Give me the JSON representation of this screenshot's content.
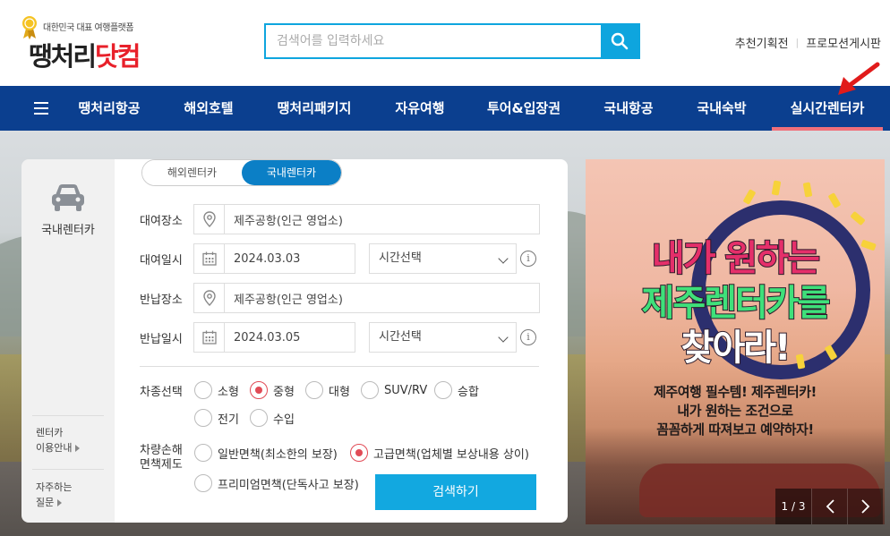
{
  "header": {
    "logo_tagline": "대한민국 대표 여행플랫폼",
    "logo_name_part1": "땡처리",
    "logo_name_part2": "닷컴",
    "search_placeholder": "검색어를 입력하세요",
    "top_links": [
      "추천기획전",
      "프로모션게시판"
    ]
  },
  "nav": {
    "items": [
      "땡처리항공",
      "해외호텔",
      "땡처리패키지",
      "자유여행",
      "투어&입장권",
      "국내항공",
      "국내숙박",
      "실시간렌터카"
    ],
    "active": "실시간렌터카",
    "active_color": "#f0707a",
    "bg_color": "#0b3f8f"
  },
  "sidepanel": {
    "title": "국내렌터카",
    "links": [
      {
        "line1": "렌터카",
        "line2": "이용안내"
      },
      {
        "line1": "자주하는",
        "line2": "질문"
      }
    ]
  },
  "form": {
    "tabs": [
      "해외렌터카",
      "국내렌터카"
    ],
    "active_tab": "국내렌터카",
    "rental_place_label": "대여장소",
    "rental_place_value": "제주공항(인근 영업소)",
    "rental_date_label": "대여일시",
    "rental_date_value": "2024.03.03",
    "rental_time_value": "시간선택",
    "return_place_label": "반납장소",
    "return_place_value": "제주공항(인근 영업소)",
    "return_date_label": "반납일시",
    "return_date_value": "2024.03.05",
    "return_time_value": "시간선택",
    "car_type_label": "차종선택",
    "car_types": [
      "소형",
      "중형",
      "대형",
      "SUV/RV",
      "승합",
      "전기",
      "수입"
    ],
    "car_type_selected": "중형",
    "insurance_label_1": "차량손해",
    "insurance_label_2": "면책제도",
    "insurance_options": [
      "일반면책(최소한의 보장)",
      "고급면책(업체별 보상내용 상이)",
      "프리미엄면책(단독사고 보장)"
    ],
    "insurance_selected": "고급면책(업체별 보상내용 상이)",
    "submit_label": "검색하기",
    "accent_color": "#12a8e0"
  },
  "banner": {
    "headline_1": "내가 원하는",
    "headline_2": "제주렌터카를",
    "headline_3": "찾아라!",
    "sub_1": "제주여행 필수템! 제주렌터카!",
    "sub_2": "내가 원하는 조건으로",
    "sub_3": "꼼꼼하게 따져보고 예약하자!",
    "pager": "1 / 3"
  }
}
